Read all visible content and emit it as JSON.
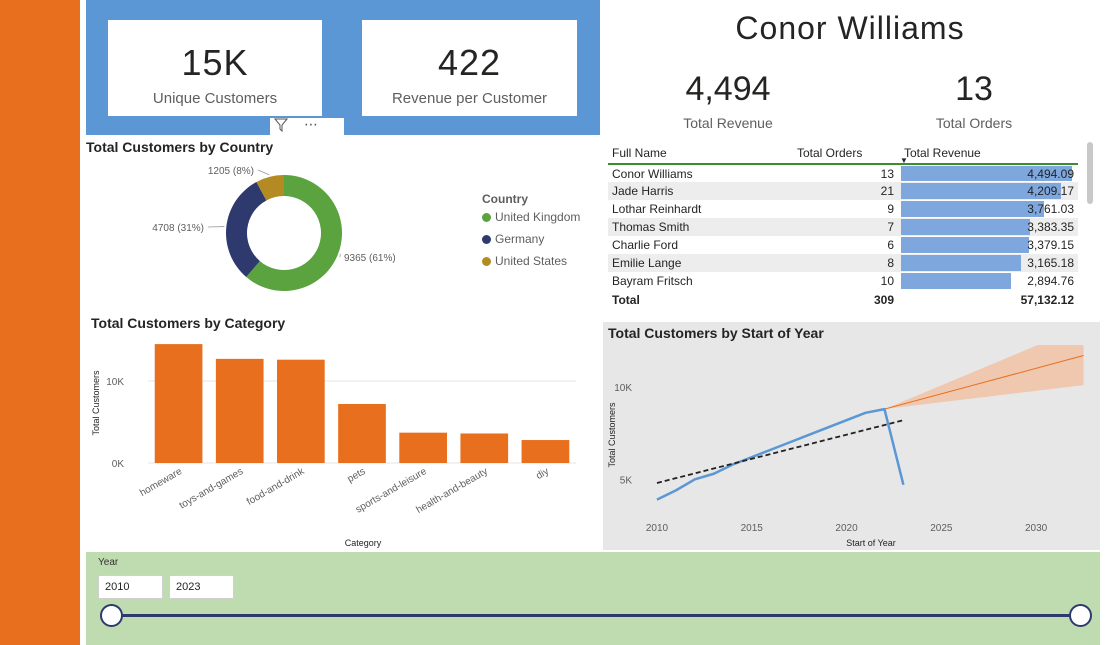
{
  "kpis": {
    "unique_customers": {
      "value": "15K",
      "label": "Unique Customers"
    },
    "revenue_per_customer": {
      "value": "422",
      "label": "Revenue per Customer"
    }
  },
  "person": {
    "name": "Conor Williams",
    "total_revenue": {
      "value": "4,494",
      "label": "Total Revenue"
    },
    "total_orders": {
      "value": "13",
      "label": "Total Orders"
    }
  },
  "visual_header_icons": [
    "filter-icon",
    "more-options-icon"
  ],
  "donut": {
    "title": "Total Customers by Country",
    "legend_title": "Country",
    "slices": [
      {
        "name": "United Kingdom",
        "value": 9365,
        "label": "9365 (61%)",
        "color": "#5BA33F"
      },
      {
        "name": "Germany",
        "value": 4708,
        "label": "4708 (31%)",
        "color": "#2E3A6D"
      },
      {
        "name": "United States",
        "value": 1205,
        "label": "1205 (8%)",
        "color": "#B48A23"
      }
    ]
  },
  "table": {
    "columns": [
      "Full Name",
      "Total Orders",
      "Total Revenue"
    ],
    "rows": [
      {
        "name": "Conor Williams",
        "orders": "13",
        "revenue": "4,494.09",
        "rev_num": 4494.09
      },
      {
        "name": "Jade Harris",
        "orders": "21",
        "revenue": "4,209.17",
        "rev_num": 4209.17
      },
      {
        "name": "Lothar Reinhardt",
        "orders": "9",
        "revenue": "3,761.03",
        "rev_num": 3761.03
      },
      {
        "name": "Thomas Smith",
        "orders": "7",
        "revenue": "3,383.35",
        "rev_num": 3383.35
      },
      {
        "name": "Charlie Ford",
        "orders": "6",
        "revenue": "3,379.15",
        "rev_num": 3379.15
      },
      {
        "name": "Emilie Lange",
        "orders": "8",
        "revenue": "3,165.18",
        "rev_num": 3165.18
      },
      {
        "name": "Bayram Fritsch",
        "orders": "10",
        "revenue": "2,894.76",
        "rev_num": 2894.76
      }
    ],
    "total": {
      "label": "Total",
      "orders": "309",
      "revenue": "57,132.12"
    },
    "bar_color": "#7DA7DD",
    "header_rule_color": "#3A8F2A"
  },
  "chart_data": [
    {
      "type": "bar",
      "title": "Total Customers by Category",
      "xlabel": "Category",
      "ylabel": "Total Customers",
      "categories": [
        "homeware",
        "toys-and-games",
        "food-and-drink",
        "pets",
        "sports-and-leisure",
        "health-and-beauty",
        "diy"
      ],
      "values": [
        14500,
        12700,
        12600,
        7200,
        3700,
        3600,
        2800
      ],
      "yticks": [
        "0K",
        "10K"
      ],
      "ylim": [
        0,
        15000
      ],
      "color": "#E86F1E"
    },
    {
      "type": "line",
      "title": "Total Customers by Start of Year",
      "xlabel": "Start of Year",
      "ylabel": "Total Customers",
      "xticks": [
        "2010",
        "2015",
        "2020",
        "2025",
        "2030"
      ],
      "yticks": [
        "5K",
        "10K"
      ],
      "xlim": [
        2009,
        2033
      ],
      "ylim": [
        3500,
        12000
      ],
      "series": [
        {
          "x": [
            2010,
            2011,
            2012,
            2013,
            2014,
            2015,
            2016,
            2017,
            2018,
            2019,
            2020,
            2021,
            2022,
            2023
          ],
          "y": [
            3900,
            4400,
            5000,
            5300,
            5800,
            6200,
            6600,
            7000,
            7400,
            7800,
            8200,
            8600,
            8800,
            4700
          ],
          "color": "#5B97D5"
        }
      ],
      "trend": {
        "x": [
          2010,
          2023
        ],
        "y": [
          4800,
          8200
        ],
        "color": "#222222"
      },
      "forecast": {
        "x": [
          2022,
          2032.5
        ],
        "y": [
          8800,
          11700
        ],
        "lower": [
          8800,
          10100
        ],
        "upper": [
          8800,
          13300
        ],
        "color": "#E86F1E",
        "band_color": "#F0C2A5"
      }
    }
  ],
  "slicer": {
    "title": "Year",
    "start": "2010",
    "end": "2023",
    "track_color": "#2E3A6D"
  }
}
